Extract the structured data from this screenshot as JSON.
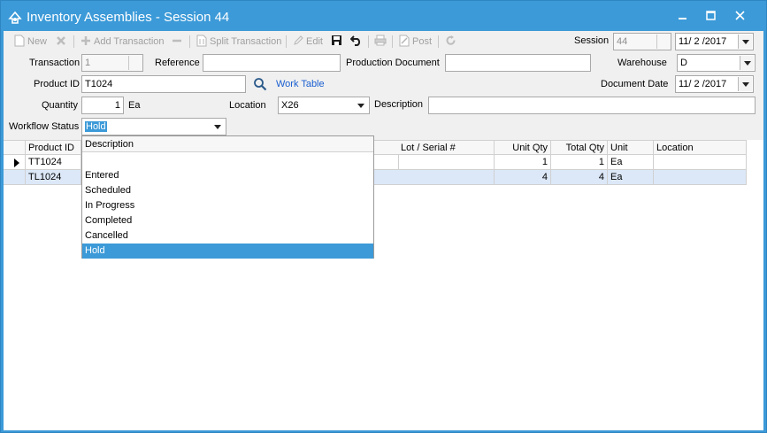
{
  "window": {
    "title": "Inventory Assemblies - Session 44"
  },
  "toolbar": {
    "new_label": "New",
    "add_transaction_label": "Add Transaction",
    "split_transaction_label": "Split Transaction",
    "edit_label": "Edit",
    "post_label": "Post"
  },
  "header": {
    "session_label": "Session",
    "session_value": "44",
    "session_date": "11/ 2 /2017",
    "transaction_label": "Transaction",
    "transaction_value": "1",
    "reference_label": "Reference",
    "reference_value": "",
    "production_document_label": "Production Document",
    "production_document_value": "",
    "warehouse_label": "Warehouse",
    "warehouse_value": "D",
    "product_id_label": "Product ID",
    "product_id_value": "T1024",
    "work_table_link": "Work Table",
    "document_date_label": "Document Date",
    "document_date_value": "11/ 2 /2017",
    "quantity_label": "Quantity",
    "quantity_value": "1",
    "quantity_unit": "Ea",
    "location_label": "Location",
    "location_value": "X26",
    "description_label": "Description",
    "description_value": "",
    "workflow_status_label": "Workflow Status",
    "workflow_status_value": "Hold"
  },
  "grid": {
    "columns": [
      "Product ID",
      "Lot / Serial #",
      "Unit Qty",
      "Total Qty",
      "Unit",
      "Location"
    ],
    "rows": [
      {
        "product_id": "TT1024",
        "lot": "",
        "unit_qty": "1",
        "total_qty": "1",
        "unit": "Ea",
        "location": ""
      },
      {
        "product_id": "TL1024",
        "lot": "",
        "unit_qty": "4",
        "total_qty": "4",
        "unit": "Ea",
        "location": ""
      }
    ]
  },
  "workflow_dropdown": {
    "header": "Description",
    "options": [
      "",
      "Entered",
      "Scheduled",
      "In Progress",
      "Completed",
      "Cancelled",
      "Hold"
    ],
    "selected": "Hold"
  }
}
